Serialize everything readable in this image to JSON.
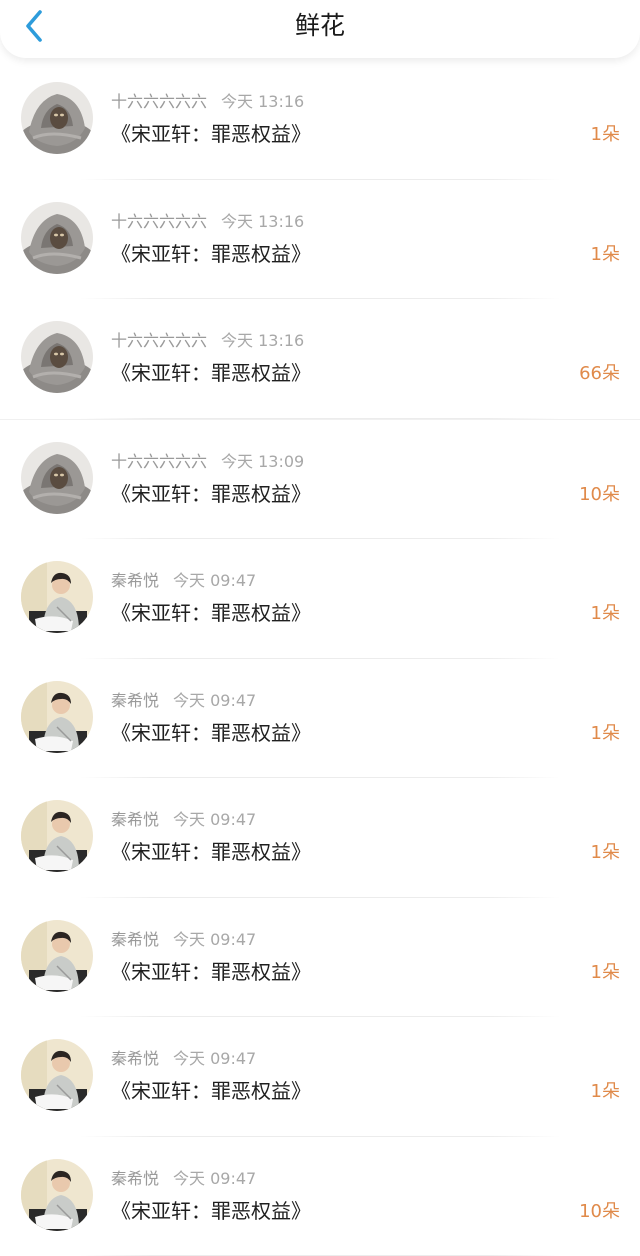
{
  "header": {
    "title": "鲜花"
  },
  "icons": {
    "back": "chevron-left-icon",
    "accent": "#2d9cdb",
    "count_color": "#e08a4a"
  },
  "items": [
    {
      "user": "十六六六六六",
      "time": "今天 13:16",
      "work": "《宋亚轩：罪恶权益》",
      "count": "1朵",
      "avatar": "gray-blanket-avatar"
    },
    {
      "user": "十六六六六六",
      "time": "今天 13:16",
      "work": "《宋亚轩：罪恶权益》",
      "count": "1朵",
      "avatar": "gray-blanket-avatar"
    },
    {
      "user": "十六六六六六",
      "time": "今天 13:16",
      "work": "《宋亚轩：罪恶权益》",
      "count": "66朵",
      "avatar": "gray-blanket-avatar"
    },
    {
      "user": "十六六六六六",
      "time": "今天 13:09",
      "work": "《宋亚轩：罪恶权益》",
      "count": "10朵",
      "avatar": "gray-blanket-avatar"
    },
    {
      "user": "秦希悦",
      "time": "今天 09:47",
      "work": "《宋亚轩：罪恶权益》",
      "count": "1朵",
      "avatar": "person-hoodie-avatar"
    },
    {
      "user": "秦希悦",
      "time": "今天 09:47",
      "work": "《宋亚轩：罪恶权益》",
      "count": "1朵",
      "avatar": "person-hoodie-avatar"
    },
    {
      "user": "秦希悦",
      "time": "今天 09:47",
      "work": "《宋亚轩：罪恶权益》",
      "count": "1朵",
      "avatar": "person-hoodie-avatar"
    },
    {
      "user": "秦希悦",
      "time": "今天 09:47",
      "work": "《宋亚轩：罪恶权益》",
      "count": "1朵",
      "avatar": "person-hoodie-avatar"
    },
    {
      "user": "秦希悦",
      "time": "今天 09:47",
      "work": "《宋亚轩：罪恶权益》",
      "count": "1朵",
      "avatar": "person-hoodie-avatar"
    },
    {
      "user": "秦希悦",
      "time": "今天 09:47",
      "work": "《宋亚轩：罪恶权益》",
      "count": "10朵",
      "avatar": "person-hoodie-avatar"
    }
  ]
}
